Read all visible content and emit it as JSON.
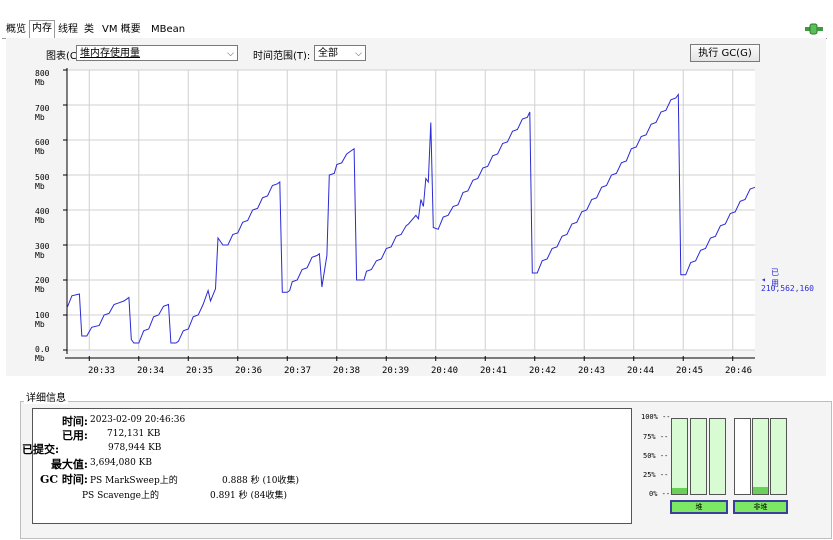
{
  "tabs": [
    {
      "label": "概览"
    },
    {
      "label": "内存"
    },
    {
      "label": "线程"
    },
    {
      "label": "类"
    },
    {
      "label": "VM 概要"
    },
    {
      "label": "MBean"
    }
  ],
  "controls": {
    "chart_label": "图表(C):",
    "chart_value": "堆内存使用量",
    "range_label": "时间范围(T):",
    "range_value": "全部",
    "gc_button": "执行 GC(G)"
  },
  "chart_data": {
    "type": "line",
    "y_ticks": [
      "800 Mb",
      "700 Mb",
      "600 Mb",
      "500 Mb",
      "400 Mb",
      "300 Mb",
      "200 Mb",
      "100 Mb",
      "0.0 Mb"
    ],
    "x_ticks": [
      "20:33",
      "20:34",
      "20:35",
      "20:36",
      "20:37",
      "20:38",
      "20:39",
      "20:40",
      "20:41",
      "20:42",
      "20:43",
      "20:44",
      "20:45",
      "20:46"
    ],
    "ylim": [
      0,
      800
    ],
    "xlim": [
      20.55,
      34.45
    ],
    "grid": true,
    "line_color": "#2a2ad6",
    "series": [
      {
        "name": "已用",
        "values": [
          [
            20.55,
            120
          ],
          [
            20.65,
            155
          ],
          [
            20.8,
            160
          ],
          [
            20.85,
            40
          ],
          [
            20.95,
            40
          ],
          [
            21.05,
            65
          ],
          [
            21.2,
            70
          ],
          [
            21.3,
            100
          ],
          [
            21.4,
            105
          ],
          [
            21.5,
            130
          ],
          [
            21.6,
            135
          ],
          [
            21.7,
            140
          ],
          [
            21.75,
            145
          ],
          [
            21.8,
            150
          ],
          [
            21.85,
            30
          ],
          [
            21.9,
            20
          ],
          [
            22.0,
            20
          ],
          [
            22.1,
            55
          ],
          [
            22.2,
            60
          ],
          [
            22.3,
            95
          ],
          [
            22.4,
            100
          ],
          [
            22.5,
            125
          ],
          [
            22.6,
            130
          ],
          [
            22.65,
            20
          ],
          [
            22.75,
            20
          ],
          [
            22.8,
            25
          ],
          [
            22.9,
            55
          ],
          [
            23.0,
            60
          ],
          [
            23.1,
            95
          ],
          [
            23.2,
            100
          ],
          [
            23.3,
            130
          ],
          [
            23.4,
            170
          ],
          [
            23.45,
            140
          ],
          [
            23.55,
            175
          ],
          [
            23.6,
            320
          ],
          [
            23.7,
            300
          ],
          [
            23.8,
            300
          ],
          [
            23.9,
            330
          ],
          [
            24.0,
            335
          ],
          [
            24.1,
            365
          ],
          [
            24.2,
            370
          ],
          [
            24.3,
            400
          ],
          [
            24.4,
            405
          ],
          [
            24.5,
            435
          ],
          [
            24.6,
            440
          ],
          [
            24.7,
            470
          ],
          [
            24.8,
            475
          ],
          [
            24.85,
            480
          ],
          [
            24.9,
            165
          ],
          [
            25.0,
            165
          ],
          [
            25.05,
            170
          ],
          [
            25.1,
            195
          ],
          [
            25.2,
            200
          ],
          [
            25.3,
            230
          ],
          [
            25.4,
            235
          ],
          [
            25.5,
            265
          ],
          [
            25.6,
            270
          ],
          [
            25.65,
            275
          ],
          [
            25.7,
            180
          ],
          [
            25.8,
            270
          ],
          [
            25.85,
            500
          ],
          [
            25.95,
            505
          ],
          [
            26.0,
            530
          ],
          [
            26.1,
            535
          ],
          [
            26.2,
            560
          ],
          [
            26.3,
            570
          ],
          [
            26.35,
            575
          ],
          [
            26.4,
            200
          ],
          [
            26.55,
            200
          ],
          [
            26.6,
            225
          ],
          [
            26.7,
            230
          ],
          [
            26.8,
            255
          ],
          [
            26.9,
            260
          ],
          [
            27.0,
            290
          ],
          [
            27.1,
            295
          ],
          [
            27.2,
            325
          ],
          [
            27.3,
            330
          ],
          [
            27.4,
            355
          ],
          [
            27.45,
            360
          ],
          [
            27.6,
            385
          ],
          [
            27.65,
            375
          ],
          [
            27.7,
            430
          ],
          [
            27.75,
            410
          ],
          [
            27.8,
            490
          ],
          [
            27.85,
            480
          ],
          [
            27.9,
            650
          ],
          [
            27.95,
            350
          ],
          [
            28.05,
            345
          ],
          [
            28.15,
            380
          ],
          [
            28.25,
            385
          ],
          [
            28.35,
            410
          ],
          [
            28.45,
            415
          ],
          [
            28.55,
            450
          ],
          [
            28.65,
            455
          ],
          [
            28.75,
            485
          ],
          [
            28.85,
            490
          ],
          [
            28.95,
            520
          ],
          [
            29.05,
            525
          ],
          [
            29.15,
            555
          ],
          [
            29.25,
            560
          ],
          [
            29.35,
            590
          ],
          [
            29.45,
            595
          ],
          [
            29.55,
            625
          ],
          [
            29.65,
            630
          ],
          [
            29.75,
            660
          ],
          [
            29.85,
            665
          ],
          [
            29.9,
            680
          ],
          [
            29.95,
            220
          ],
          [
            30.05,
            220
          ],
          [
            30.15,
            255
          ],
          [
            30.25,
            260
          ],
          [
            30.35,
            290
          ],
          [
            30.45,
            295
          ],
          [
            30.55,
            325
          ],
          [
            30.65,
            330
          ],
          [
            30.75,
            360
          ],
          [
            30.85,
            365
          ],
          [
            30.95,
            395
          ],
          [
            31.05,
            400
          ],
          [
            31.15,
            430
          ],
          [
            31.25,
            435
          ],
          [
            31.35,
            465
          ],
          [
            31.45,
            470
          ],
          [
            31.55,
            500
          ],
          [
            31.65,
            505
          ],
          [
            31.75,
            535
          ],
          [
            31.85,
            540
          ],
          [
            31.95,
            575
          ],
          [
            32.05,
            580
          ],
          [
            32.15,
            610
          ],
          [
            32.25,
            615
          ],
          [
            32.35,
            645
          ],
          [
            32.45,
            650
          ],
          [
            32.55,
            680
          ],
          [
            32.65,
            685
          ],
          [
            32.75,
            715
          ],
          [
            32.85,
            720
          ],
          [
            32.9,
            730
          ],
          [
            32.95,
            215
          ],
          [
            33.05,
            215
          ],
          [
            33.15,
            250
          ],
          [
            33.25,
            255
          ],
          [
            33.35,
            285
          ],
          [
            33.45,
            290
          ],
          [
            33.55,
            320
          ],
          [
            33.65,
            325
          ],
          [
            33.75,
            355
          ],
          [
            33.85,
            360
          ],
          [
            33.95,
            390
          ],
          [
            34.05,
            395
          ],
          [
            34.15,
            425
          ],
          [
            34.25,
            430
          ],
          [
            34.35,
            460
          ],
          [
            34.45,
            465
          ]
        ]
      }
    ],
    "current_marker": {
      "label": "已用",
      "value": "210,562,160"
    }
  },
  "details": {
    "header": "详细信息",
    "time_label": "时间:",
    "time_value": "2023-02-09 20:46:36",
    "used_label": "已用:",
    "used_value": "712,131 KB",
    "committed_label": "已提交:",
    "committed_value": "978,944 KB",
    "max_label": "最大值:",
    "max_value": "3,694,080 KB",
    "gc_label": "GC 时间:",
    "gc1_name": "PS MarkSweep上的",
    "gc1_value": "0.888 秒 (10收集)",
    "gc2_name": "PS Scavenge上的",
    "gc2_value": "0.891 秒 (84收集)"
  },
  "bars": {
    "pct_labels": [
      "100% --",
      "75% --",
      "50% --",
      "25% --",
      "0% --"
    ],
    "heap_label": "堆",
    "nonheap_label": "非堆",
    "levels": [
      8,
      0,
      0,
      0,
      10,
      0
    ]
  }
}
